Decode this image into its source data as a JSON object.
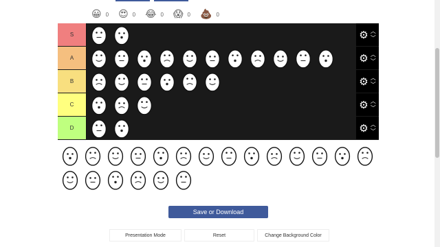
{
  "reactions": [
    {
      "icon": "😀",
      "name": "smile",
      "count": "0"
    },
    {
      "icon": "😍",
      "name": "heart-eyes",
      "count": "0"
    },
    {
      "icon": "😂",
      "name": "laughing",
      "count": "0"
    },
    {
      "icon": "😱",
      "name": "screaming",
      "count": "0"
    },
    {
      "icon": "💩",
      "name": "poop",
      "count": "0"
    }
  ],
  "tiers": [
    {
      "label": "S",
      "color": "#f07f7f",
      "items": [
        "bucket-hat-egg",
        "plain-brown-egg"
      ]
    },
    {
      "label": "A",
      "color": "#f5bf7f",
      "items": [
        "sunglasses-egg",
        "helmet-egg",
        "crown-egg",
        "surprised-egg",
        "angry-egg",
        "plain-egg",
        "bandit-egg",
        "neutral-egg",
        "cheeky-egg",
        "mask-egg",
        "moustache-egg"
      ]
    },
    {
      "label": "B",
      "color": "#f8df7f",
      "items": [
        "happy-egg",
        "monocle-egg",
        "shades-egg",
        "tongue-egg",
        "grumpy-egg",
        "blank-egg"
      ]
    },
    {
      "label": "C",
      "color": "#ffff7f",
      "items": [
        "cap-egg",
        "fang-egg",
        "suit-egg"
      ]
    },
    {
      "label": "D",
      "color": "#bfff7f",
      "items": [
        "hairy-egg",
        "skull-egg"
      ]
    }
  ],
  "pool": [
    "moustache-egg-2",
    "cross-egg",
    "shocked-egg",
    "side-egg",
    "bird-egg",
    "rosy-egg",
    "shy-egg",
    "flower-egg",
    "frown-egg",
    "sleepy-egg",
    "blush-egg",
    "target-egg",
    "punk-egg",
    "smirk-egg",
    "stitch-egg",
    "glasses-egg",
    "squint-egg",
    "green-egg",
    "bored-egg",
    "pale-egg"
  ],
  "buttons": {
    "save": "Save or Download",
    "presentation": "Presentation Mode",
    "reset": "Reset",
    "background": "Change Background Color"
  }
}
